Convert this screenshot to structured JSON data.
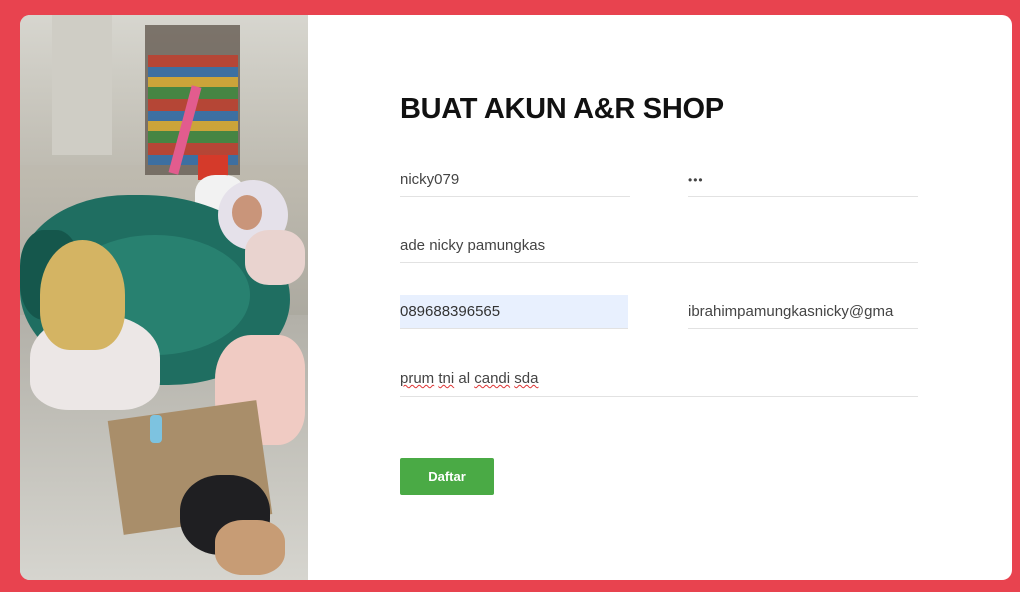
{
  "page": {
    "title": "BUAT AKUN A&R SHOP",
    "accent_color": "#4aaa45",
    "background_color": "#e8434f"
  },
  "photo": {
    "icon": "workshop-photo"
  },
  "form": {
    "username": {
      "value": "nicky079"
    },
    "password": {
      "value": "•••"
    },
    "fullname": {
      "value": "ade nicky pamungkas"
    },
    "phone": {
      "value": "089688396565"
    },
    "email": {
      "value": "ibrahimpamungkasnicky@gma"
    },
    "address": {
      "value": "prum tni al candi sda",
      "words": [
        "prum",
        "tni",
        "al",
        "candi",
        "sda"
      ]
    },
    "submit_label": "Daftar"
  }
}
